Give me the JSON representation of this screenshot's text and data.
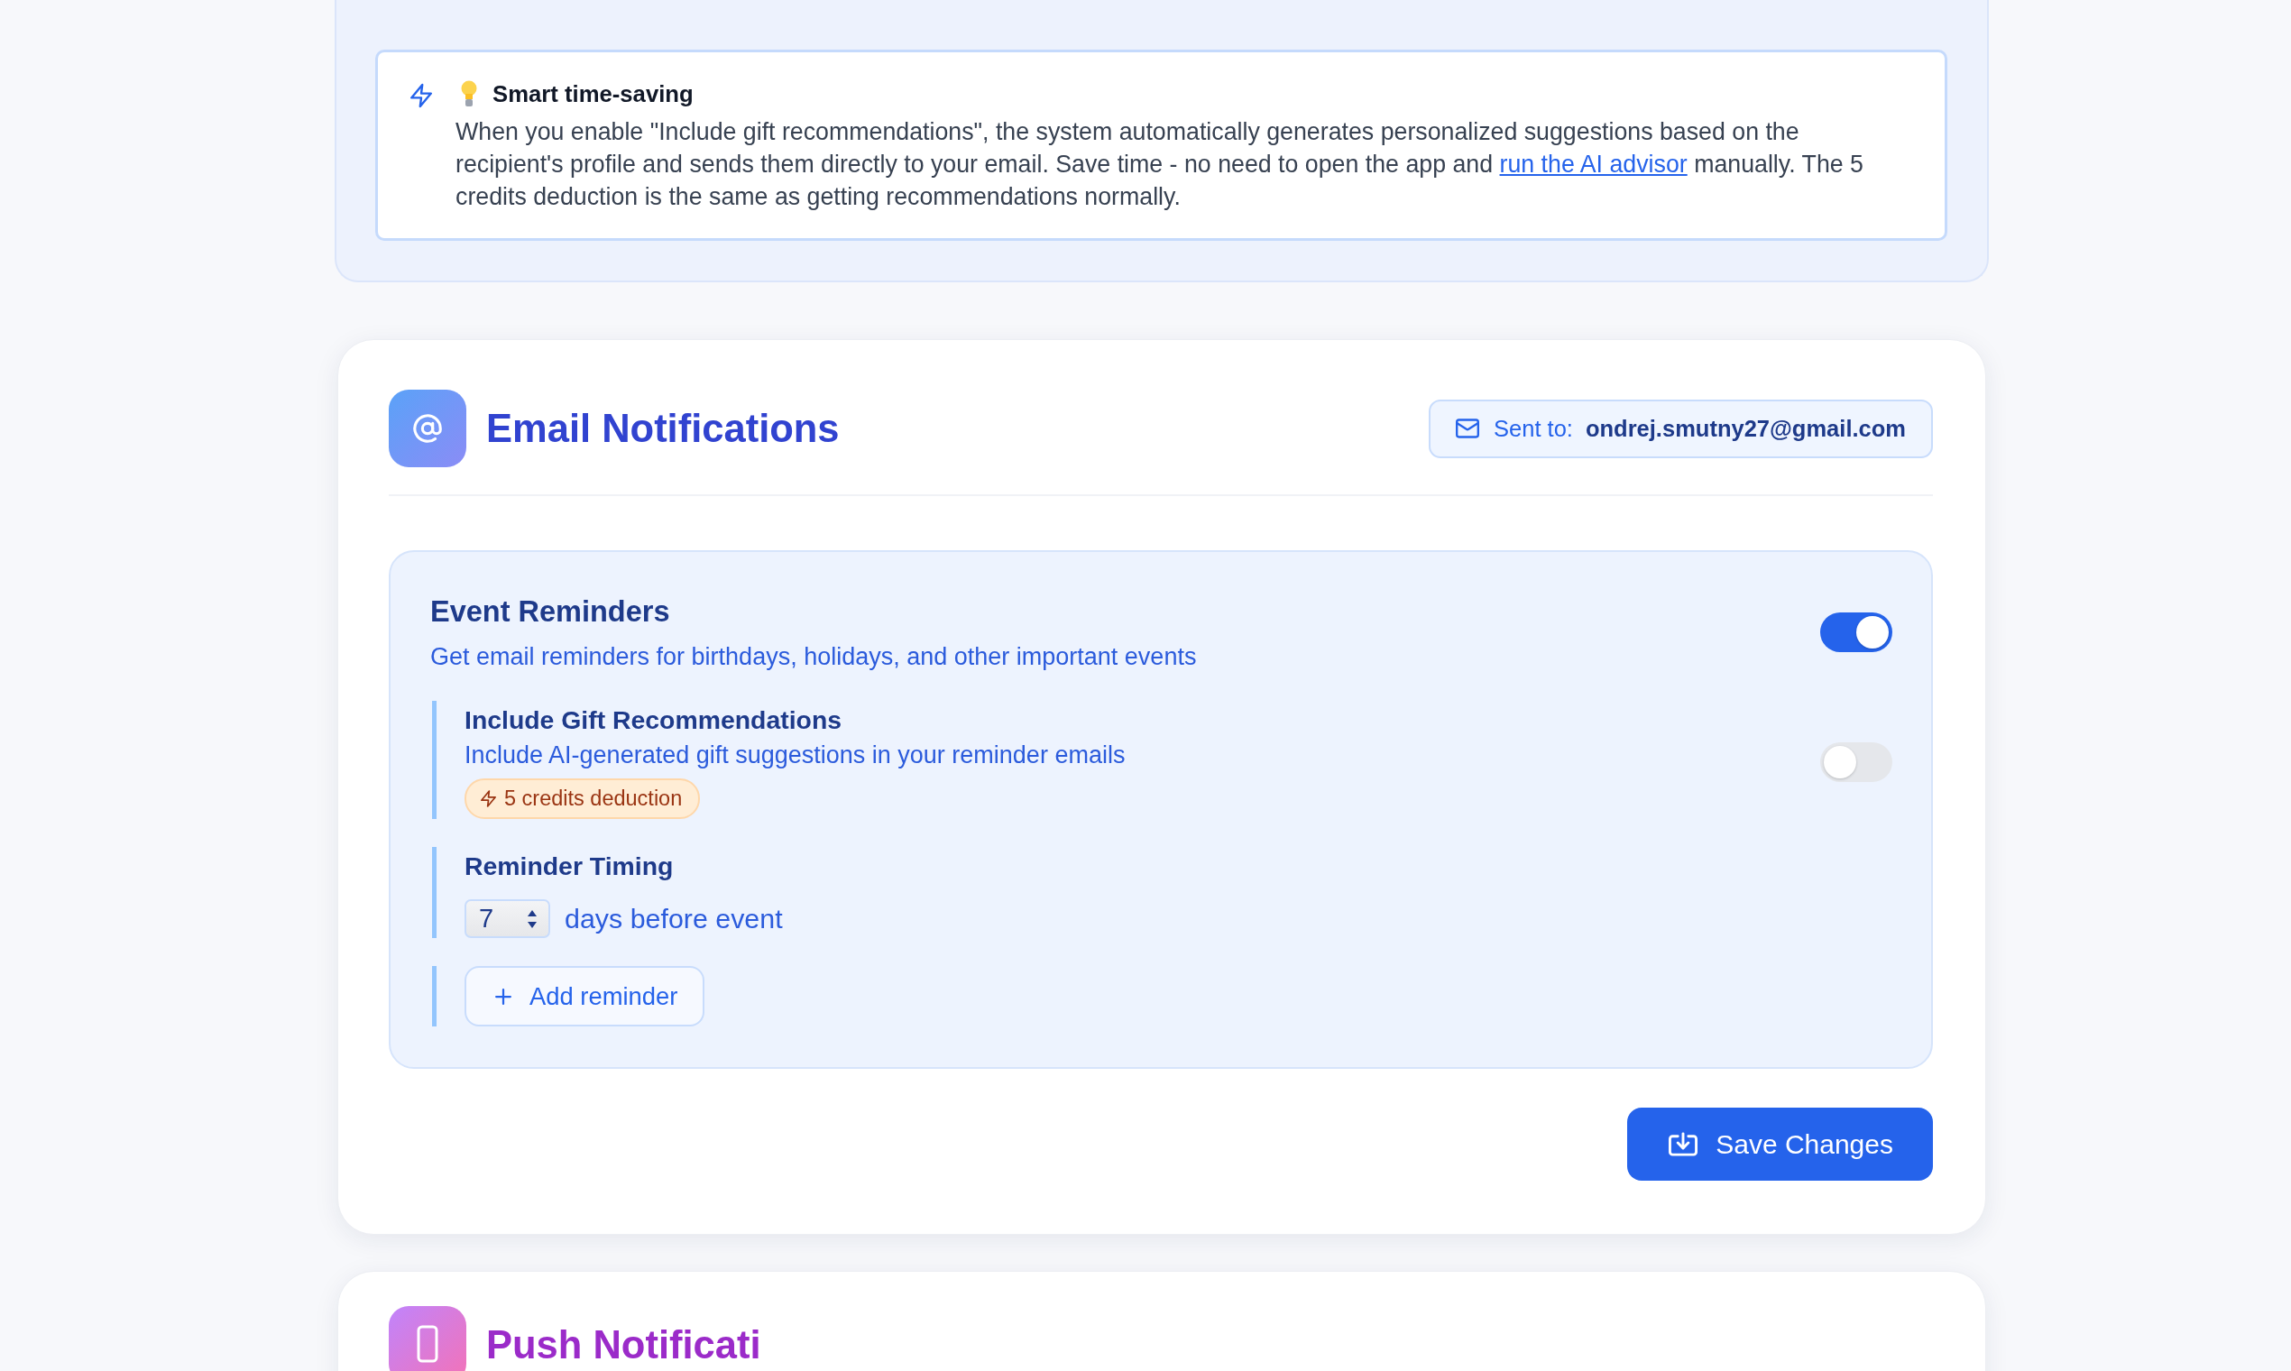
{
  "tip": {
    "title": "Smart time-saving",
    "body": [
      {
        "kind": "text",
        "text": "When you enable \"Include gift recommendations\", the system automatically generates personalized suggestions based on the recipient's profile and sends them directly to your email. Save time - no need to open the app and "
      },
      {
        "kind": "link",
        "text": "run the AI advisor"
      },
      {
        "kind": "text",
        "text": " manually. The 5 credits deduction is the same as getting recommendations normally."
      }
    ]
  },
  "email_section": {
    "title": "Email Notifications",
    "sent_to": {
      "label": "Sent to:",
      "address": "ondrej.smutny27@gmail.com"
    },
    "event_reminders": {
      "title": "Event Reminders",
      "description": "Get email reminders for birthdays, holidays, and other important events",
      "on": true,
      "options": [
        {
          "kind": "toggle",
          "title": "Include Gift Recommendations",
          "description": "Include AI-generated gift suggestions in your reminder emails",
          "badge": "5 credits deduction",
          "on": false
        },
        {
          "kind": "timing",
          "title": "Reminder Timing",
          "value": "7",
          "unit": "days before event"
        },
        {
          "kind": "add",
          "label": "Add reminder"
        }
      ]
    },
    "save_button": "Save Changes"
  },
  "push_section": {
    "title": "Push Notificati"
  }
}
